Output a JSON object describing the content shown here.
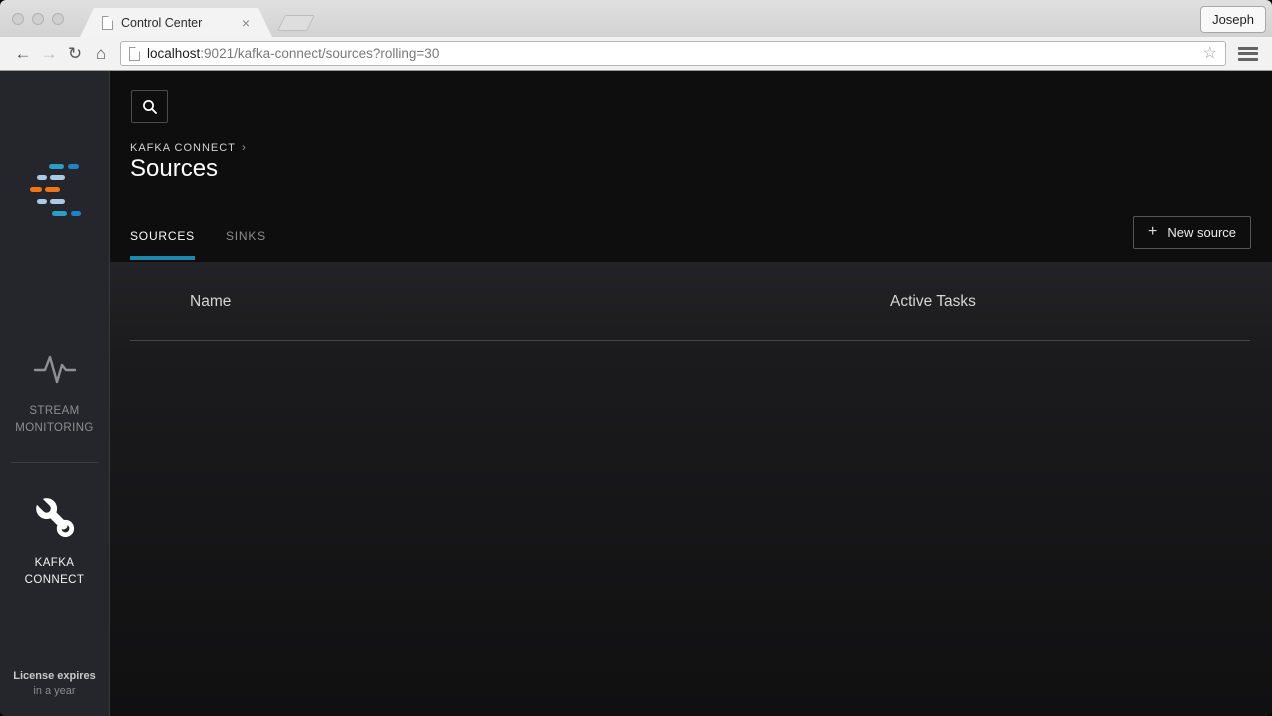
{
  "window": {
    "tab_title": "Control Center",
    "tab_close_glyph": "×",
    "profile_name": "Joseph",
    "url": {
      "host": "localhost",
      "rest": ":9021/kafka-connect/sources?rolling=30"
    },
    "icons": {
      "back": "←",
      "forward": "→",
      "reload": "↻",
      "home": "⌂",
      "bookmark_star": "☆"
    }
  },
  "sidebar": {
    "items": [
      {
        "icon": "pulse-icon",
        "label_line1": "STREAM",
        "label_line2": "MONITORING",
        "active": false
      },
      {
        "icon": "wrench-icon",
        "label_line1": "KAFKA",
        "label_line2": "CONNECT",
        "active": true
      }
    ],
    "license": {
      "line1": "License expires",
      "line2": "in a year"
    }
  },
  "content": {
    "breadcrumb": {
      "label": "KAFKA CONNECT",
      "chevron": "›"
    },
    "page_title": "Sources",
    "tabs": [
      {
        "label": "SOURCES",
        "active": true
      },
      {
        "label": "SINKS",
        "active": false
      }
    ],
    "new_source_button": {
      "plus_glyph": "+",
      "label": "New source"
    },
    "table": {
      "columns": [
        "Name",
        "Active Tasks"
      ],
      "rows": []
    }
  },
  "colors": {
    "accent_tab_underline": "#1f87ab",
    "logo_orange": "#ee7618",
    "logo_light_blue": "#a9c9e4",
    "logo_cyan": "#2b9dc7",
    "logo_blue": "#1e84c8",
    "sidebar_bg": "#25262b",
    "content_bg": "#0e0e0f"
  }
}
